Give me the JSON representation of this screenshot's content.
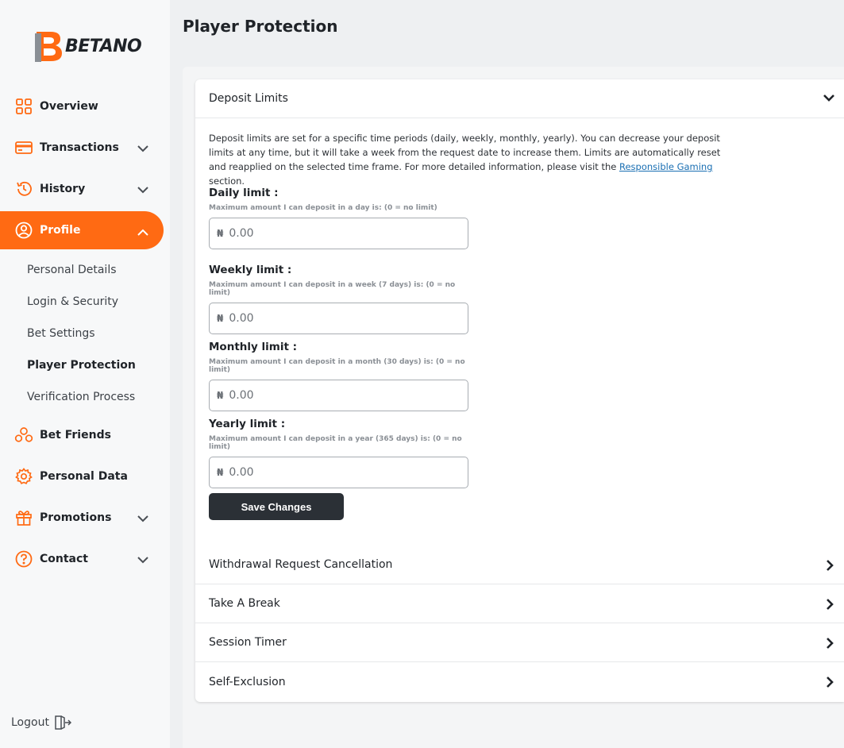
{
  "brand": {
    "name": "BETANO",
    "accent": "#ff6a13"
  },
  "sidebar": {
    "items": [
      {
        "label": "Overview",
        "icon": "grid-icon"
      },
      {
        "label": "Transactions",
        "icon": "card-icon",
        "expandable": true
      },
      {
        "label": "History",
        "icon": "history-icon",
        "expandable": true
      },
      {
        "label": "Profile",
        "icon": "user-icon",
        "expandable": true,
        "active": true
      },
      {
        "label": "Bet Friends",
        "icon": "friends-icon"
      },
      {
        "label": "Personal Data",
        "icon": "gear-icon"
      },
      {
        "label": "Promotions",
        "icon": "gift-icon",
        "expandable": true
      },
      {
        "label": "Contact",
        "icon": "question-icon",
        "expandable": true
      }
    ],
    "profile_sub": [
      "Personal Details",
      "Login & Security",
      "Bet Settings",
      "Player Protection",
      "Verification Process"
    ],
    "logout": "Logout"
  },
  "page": {
    "title": "Player Protection"
  },
  "deposit": {
    "header": "Deposit Limits",
    "intro_before": "Deposit limits are set for a specific time periods (daily, weekly, monthly, yearly). You can decrease your deposit limits at any time, but it will take a week from the request date to increase them. Limits are automatically reset and reapplied on the selected time frame. For more detailed information, please visit the ",
    "intro_link": "Responsible Gaming",
    "intro_after": " section.",
    "currency": "₦",
    "limits": [
      {
        "title": "Daily limit :",
        "hint": "Maximum amount I can deposit in a day is: (0 = no limit)",
        "value": "0.00"
      },
      {
        "title": "Weekly limit :",
        "hint": "Maximum amount I can deposit in a week (7 days) is: (0 = no limit)",
        "value": "0.00"
      },
      {
        "title": "Monthly limit :",
        "hint": "Maximum amount I can deposit in a month (30 days) is: (0 = no limit)",
        "value": "0.00"
      },
      {
        "title": "Yearly limit :",
        "hint": "Maximum amount I can deposit in a year (365 days) is: (0 = no limit)",
        "value": "0.00"
      }
    ],
    "save_label": "Save Changes"
  },
  "sections": [
    "Withdrawal Request Cancellation",
    "Take A Break",
    "Session Timer",
    "Self-Exclusion"
  ]
}
